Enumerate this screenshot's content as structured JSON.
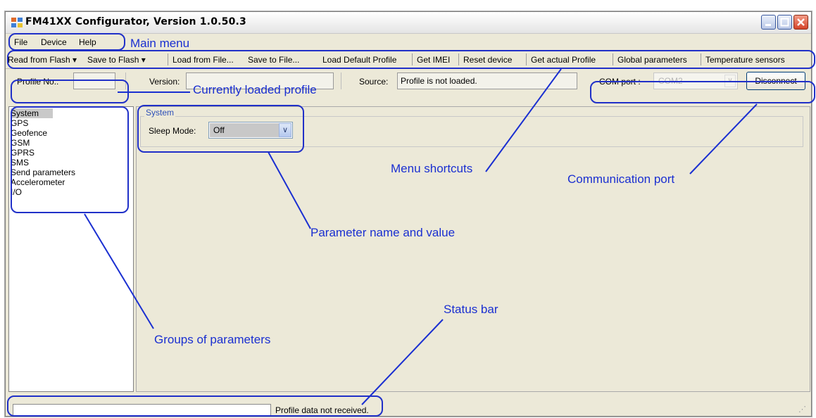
{
  "window": {
    "title": "FM41XX Configurator, Version 1.0.50.3"
  },
  "menu": {
    "file": "File",
    "device": "Device",
    "help": "Help"
  },
  "toolbar": {
    "read_flash": "Read from Flash",
    "save_flash": "Save to Flash",
    "load_file": "Load from File...",
    "save_file": "Save to File...",
    "load_default": "Load Default Profile",
    "get_imei": "Get IMEI",
    "reset": "Reset device",
    "get_actual": "Get actual Profile",
    "global": "Global parameters",
    "temp": "Temperature sensors"
  },
  "info": {
    "profile_no_label": "Profile No.:",
    "profile_no_value": "",
    "version_label": "Version:",
    "source_label": "Source:",
    "source_value": "Profile is not loaded.",
    "com_label": "COM port :",
    "com_value": "COM2",
    "disconnect": "Disconnect"
  },
  "groups": [
    "System",
    "GPS",
    "Geofence",
    "GSM",
    "GPRS",
    "SMS",
    "Send parameters",
    "Accelerometer",
    "I/O"
  ],
  "panel": {
    "legend": "System",
    "sleep_label": "Sleep Mode:",
    "sleep_value": "Off"
  },
  "status": {
    "message": "Profile data not received."
  },
  "annotations": {
    "main_menu": "Main menu",
    "loaded_profile": "Currently loaded profile",
    "menu_shortcuts": "Menu shortcuts",
    "comm_port": "Communication port",
    "param_name_value": "Parameter name and value",
    "status_bar": "Status bar",
    "groups_params": "Groups of parameters"
  },
  "colors": {
    "annotation": "#1a2fd1",
    "window_bg": "#ece9d8"
  }
}
